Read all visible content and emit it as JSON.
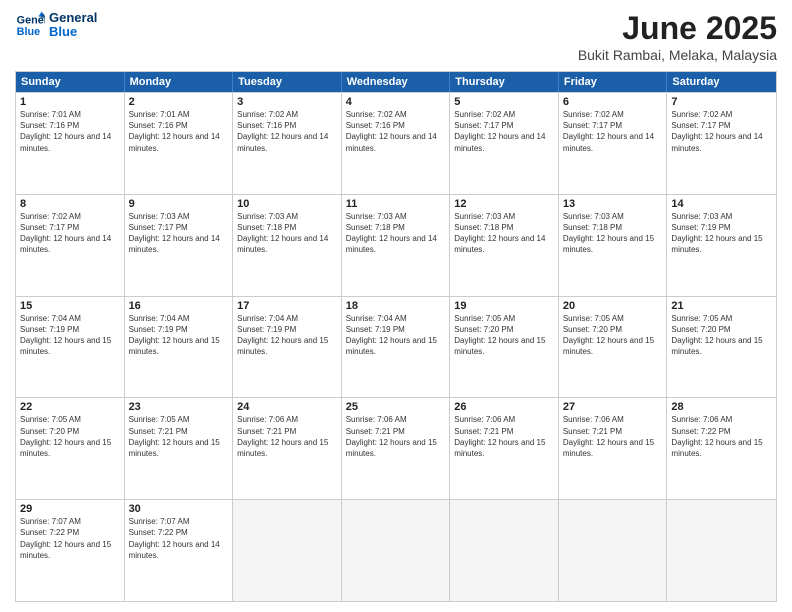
{
  "logo": {
    "line1": "General",
    "line2": "Blue"
  },
  "title": "June 2025",
  "location": "Bukit Rambai, Melaka, Malaysia",
  "days_of_week": [
    "Sunday",
    "Monday",
    "Tuesday",
    "Wednesday",
    "Thursday",
    "Friday",
    "Saturday"
  ],
  "weeks": [
    [
      {
        "day": 1,
        "sunrise": "7:01 AM",
        "sunset": "7:16 PM",
        "daylight": "12 hours and 14 minutes."
      },
      {
        "day": 2,
        "sunrise": "7:01 AM",
        "sunset": "7:16 PM",
        "daylight": "12 hours and 14 minutes."
      },
      {
        "day": 3,
        "sunrise": "7:02 AM",
        "sunset": "7:16 PM",
        "daylight": "12 hours and 14 minutes."
      },
      {
        "day": 4,
        "sunrise": "7:02 AM",
        "sunset": "7:16 PM",
        "daylight": "12 hours and 14 minutes."
      },
      {
        "day": 5,
        "sunrise": "7:02 AM",
        "sunset": "7:17 PM",
        "daylight": "12 hours and 14 minutes."
      },
      {
        "day": 6,
        "sunrise": "7:02 AM",
        "sunset": "7:17 PM",
        "daylight": "12 hours and 14 minutes."
      },
      {
        "day": 7,
        "sunrise": "7:02 AM",
        "sunset": "7:17 PM",
        "daylight": "12 hours and 14 minutes."
      }
    ],
    [
      {
        "day": 8,
        "sunrise": "7:02 AM",
        "sunset": "7:17 PM",
        "daylight": "12 hours and 14 minutes."
      },
      {
        "day": 9,
        "sunrise": "7:03 AM",
        "sunset": "7:17 PM",
        "daylight": "12 hours and 14 minutes."
      },
      {
        "day": 10,
        "sunrise": "7:03 AM",
        "sunset": "7:18 PM",
        "daylight": "12 hours and 14 minutes."
      },
      {
        "day": 11,
        "sunrise": "7:03 AM",
        "sunset": "7:18 PM",
        "daylight": "12 hours and 14 minutes."
      },
      {
        "day": 12,
        "sunrise": "7:03 AM",
        "sunset": "7:18 PM",
        "daylight": "12 hours and 14 minutes."
      },
      {
        "day": 13,
        "sunrise": "7:03 AM",
        "sunset": "7:18 PM",
        "daylight": "12 hours and 15 minutes."
      },
      {
        "day": 14,
        "sunrise": "7:03 AM",
        "sunset": "7:19 PM",
        "daylight": "12 hours and 15 minutes."
      }
    ],
    [
      {
        "day": 15,
        "sunrise": "7:04 AM",
        "sunset": "7:19 PM",
        "daylight": "12 hours and 15 minutes."
      },
      {
        "day": 16,
        "sunrise": "7:04 AM",
        "sunset": "7:19 PM",
        "daylight": "12 hours and 15 minutes."
      },
      {
        "day": 17,
        "sunrise": "7:04 AM",
        "sunset": "7:19 PM",
        "daylight": "12 hours and 15 minutes."
      },
      {
        "day": 18,
        "sunrise": "7:04 AM",
        "sunset": "7:19 PM",
        "daylight": "12 hours and 15 minutes."
      },
      {
        "day": 19,
        "sunrise": "7:05 AM",
        "sunset": "7:20 PM",
        "daylight": "12 hours and 15 minutes."
      },
      {
        "day": 20,
        "sunrise": "7:05 AM",
        "sunset": "7:20 PM",
        "daylight": "12 hours and 15 minutes."
      },
      {
        "day": 21,
        "sunrise": "7:05 AM",
        "sunset": "7:20 PM",
        "daylight": "12 hours and 15 minutes."
      }
    ],
    [
      {
        "day": 22,
        "sunrise": "7:05 AM",
        "sunset": "7:20 PM",
        "daylight": "12 hours and 15 minutes."
      },
      {
        "day": 23,
        "sunrise": "7:05 AM",
        "sunset": "7:21 PM",
        "daylight": "12 hours and 15 minutes."
      },
      {
        "day": 24,
        "sunrise": "7:06 AM",
        "sunset": "7:21 PM",
        "daylight": "12 hours and 15 minutes."
      },
      {
        "day": 25,
        "sunrise": "7:06 AM",
        "sunset": "7:21 PM",
        "daylight": "12 hours and 15 minutes."
      },
      {
        "day": 26,
        "sunrise": "7:06 AM",
        "sunset": "7:21 PM",
        "daylight": "12 hours and 15 minutes."
      },
      {
        "day": 27,
        "sunrise": "7:06 AM",
        "sunset": "7:21 PM",
        "daylight": "12 hours and 15 minutes."
      },
      {
        "day": 28,
        "sunrise": "7:06 AM",
        "sunset": "7:22 PM",
        "daylight": "12 hours and 15 minutes."
      }
    ],
    [
      {
        "day": 29,
        "sunrise": "7:07 AM",
        "sunset": "7:22 PM",
        "daylight": "12 hours and 15 minutes."
      },
      {
        "day": 30,
        "sunrise": "7:07 AM",
        "sunset": "7:22 PM",
        "daylight": "12 hours and 14 minutes."
      },
      null,
      null,
      null,
      null,
      null
    ]
  ]
}
